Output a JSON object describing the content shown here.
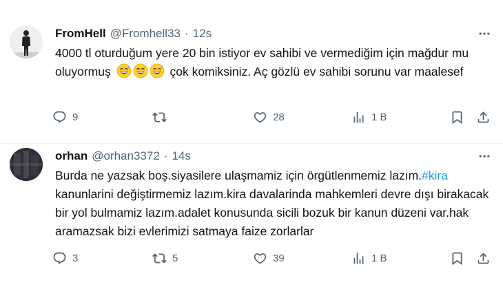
{
  "tweets": [
    {
      "name": "FromHell",
      "handle": "@Fromhell33",
      "sep": "·",
      "time": "12s",
      "text_before": "4000 tl oturduğum yere 20 bin istiyor ev sahibi ve vermediğim için mağdur mu oluyormuş",
      "emojis": [
        "sweat-smile-emoji",
        "sweat-smile-emoji",
        "sweat-smile-emoji"
      ],
      "text_after": "çok komiksiniz. Aç gözlü ev sahibi sorunu var maalesef",
      "actions": {
        "replies": "9",
        "reposts": "",
        "likes": "28",
        "views": "1 B"
      }
    },
    {
      "name": "orhan",
      "handle": "@orhan3372",
      "sep": "·",
      "time": "14s",
      "text_before": "Burda ne yazsak boş.siyasilere ulaşmamiz için örgütlenmemiz lazım.",
      "hashtag": "#kira",
      "text_after": "kanunlarini değiştirmemiz lazım.kira davalarinda mahkemleri devre dışı birakacak bir yol bulmamiz lazım.adalet konusunda sicili bozuk bir kanun düzeni var.hak aramazsak bizi evlerimizi satmaya faize zorlarlar",
      "actions": {
        "replies": "3",
        "reposts": "5",
        "likes": "39",
        "views": "1 B"
      }
    }
  ],
  "colors": {
    "text": "#0f1419",
    "muted": "#536471",
    "link": "#1d9bf0",
    "divider": "#eff3f4"
  }
}
